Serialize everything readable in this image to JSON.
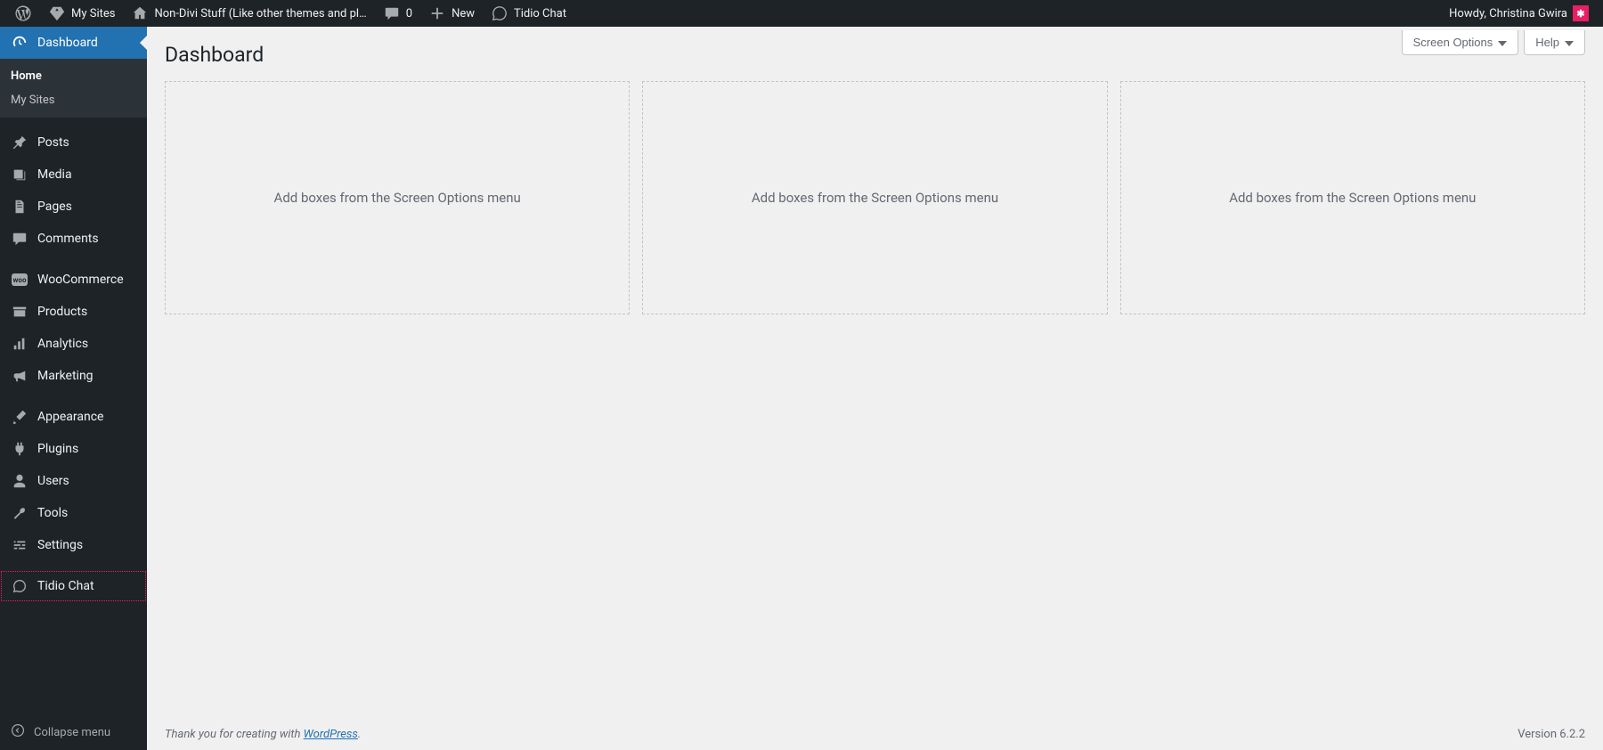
{
  "adminbar": {
    "my_sites": "My Sites",
    "site_name": "Non-Divi Stuff (Like other themes and pl…",
    "comments_count": "0",
    "new": "New",
    "tidio": "Tidio Chat",
    "howdy": "Howdy, Christina Gwira"
  },
  "sidebar": {
    "dashboard": "Dashboard",
    "submenu": {
      "home": "Home",
      "my_sites": "My Sites"
    },
    "posts": "Posts",
    "media": "Media",
    "pages": "Pages",
    "comments": "Comments",
    "woocommerce": "WooCommerce",
    "products": "Products",
    "analytics": "Analytics",
    "marketing": "Marketing",
    "appearance": "Appearance",
    "plugins": "Plugins",
    "users": "Users",
    "tools": "Tools",
    "settings": "Settings",
    "tidio": "Tidio Chat",
    "collapse": "Collapse menu"
  },
  "content": {
    "screen_options": "Screen Options",
    "help": "Help",
    "title": "Dashboard",
    "box_placeholder": "Add boxes from the Screen Options menu"
  },
  "footer": {
    "thanks": "Thank you for creating with ",
    "link_text": "WordPress",
    "version": "Version 6.2.2"
  }
}
